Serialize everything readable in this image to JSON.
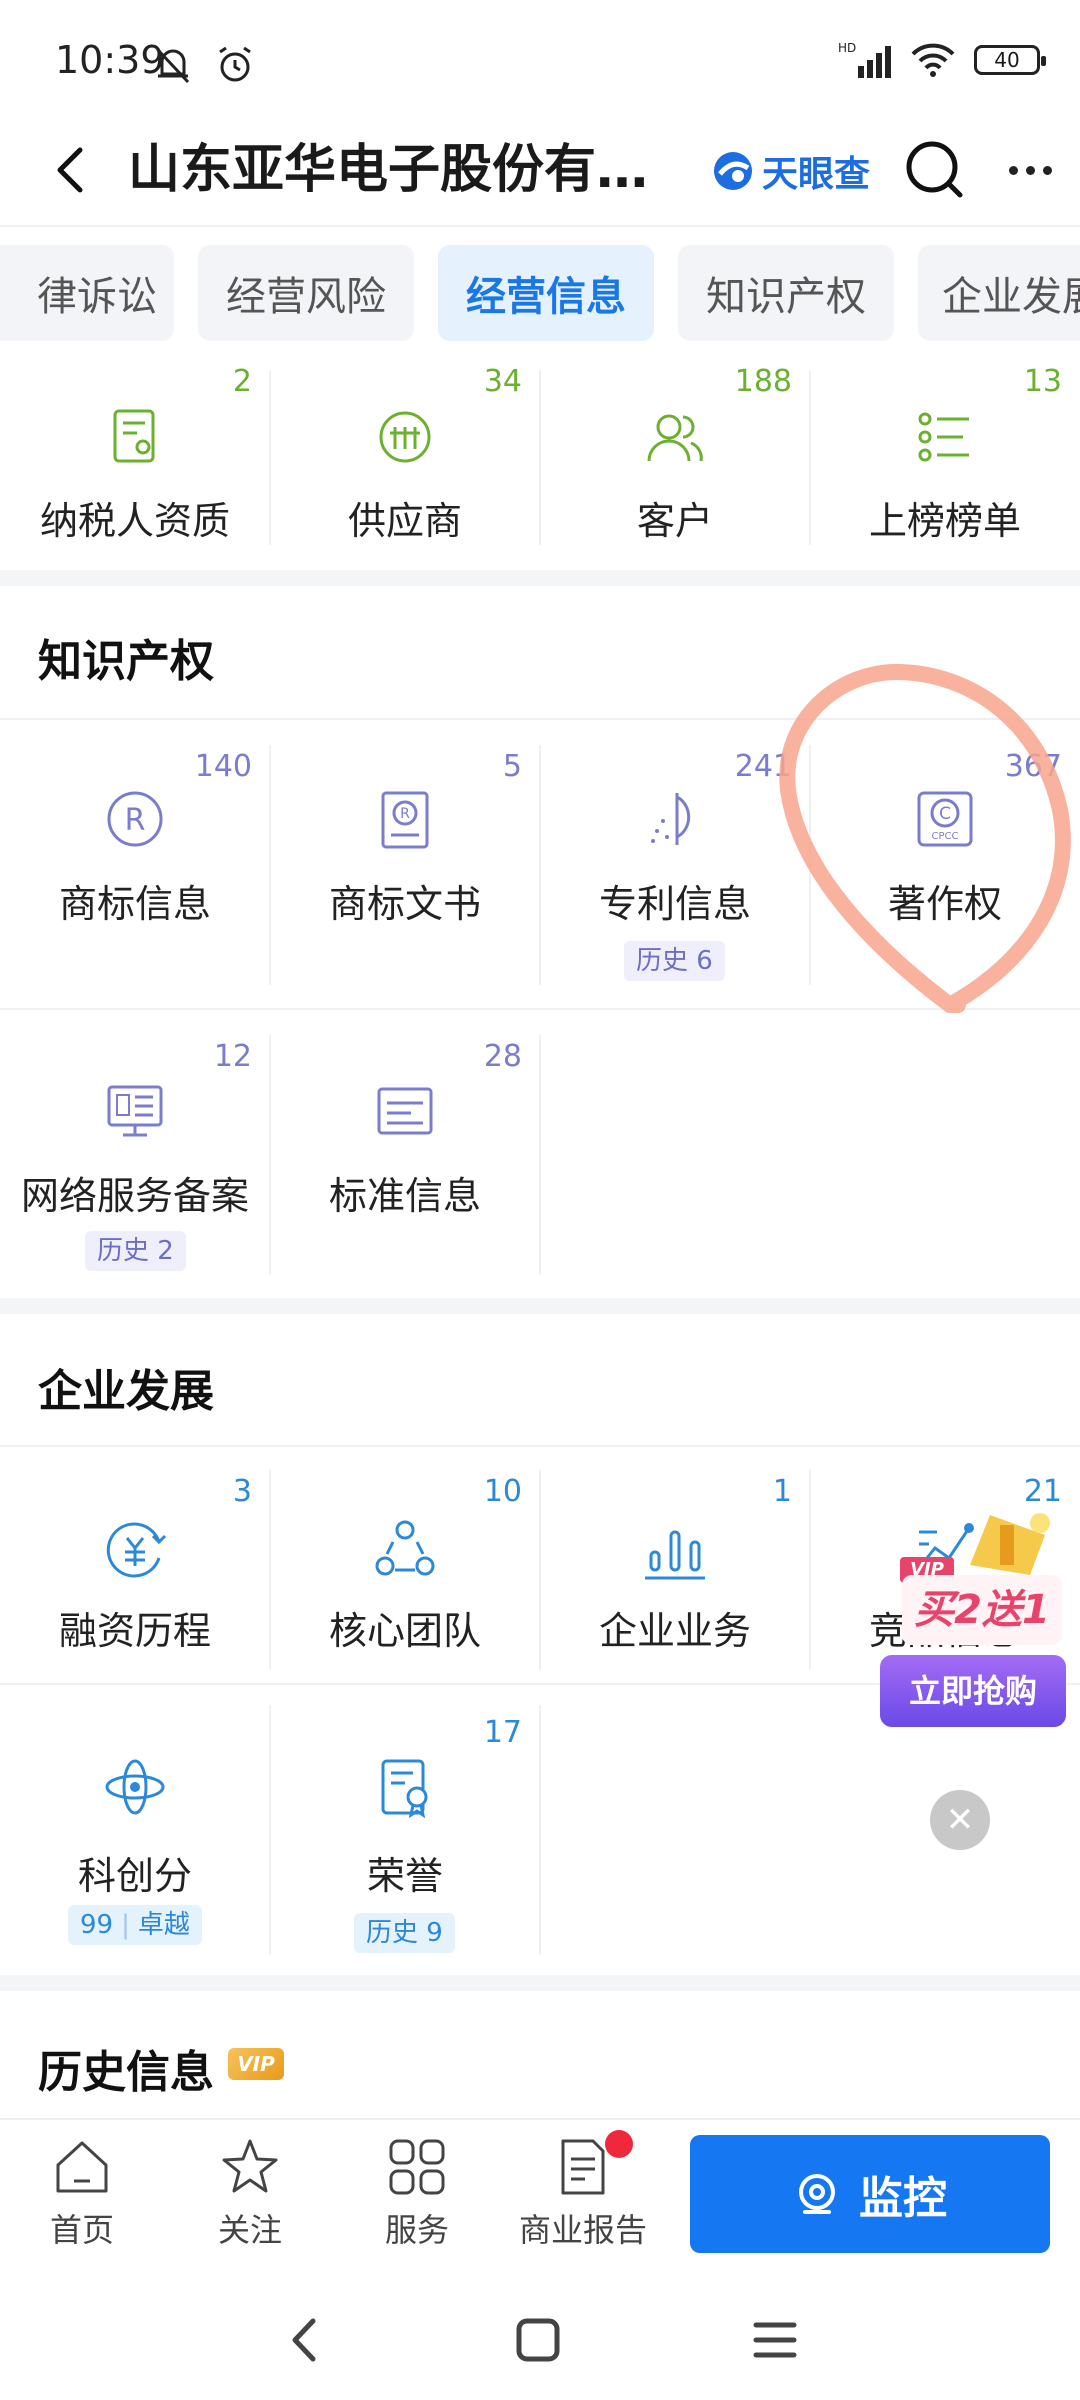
{
  "status_bar": {
    "time": "10:39",
    "network": "HD",
    "battery": "40"
  },
  "header": {
    "title": "山东亚华电子股份有限公司",
    "brand": "天眼查"
  },
  "tabs": [
    {
      "label": "律诉讼",
      "active": false
    },
    {
      "label": "经营风险",
      "active": false
    },
    {
      "label": "经营信息",
      "active": true
    },
    {
      "label": "知识产权",
      "active": false
    },
    {
      "label": "企业发展",
      "active": false
    }
  ],
  "business_row": [
    {
      "count": "2",
      "label": "纳税人资质",
      "icon": "tax-certificate-icon"
    },
    {
      "count": "34",
      "label": "供应商",
      "icon": "supplier-icon"
    },
    {
      "count": "188",
      "label": "客户",
      "icon": "customer-icon"
    },
    {
      "count": "13",
      "label": "上榜榜单",
      "icon": "ranking-list-icon"
    }
  ],
  "ip_section": {
    "title": "知识产权",
    "items": [
      {
        "count": "140",
        "label": "商标信息",
        "icon": "trademark-icon"
      },
      {
        "count": "5",
        "label": "商标文书",
        "icon": "trademark-document-icon"
      },
      {
        "count": "241",
        "label": "专利信息",
        "icon": "patent-icon",
        "history": "历史 6"
      },
      {
        "count": "367",
        "label": "著作权",
        "icon": "copyright-cpcc-icon"
      },
      {
        "count": "12",
        "label": "网络服务备案",
        "icon": "network-filing-icon",
        "history": "历史 2"
      },
      {
        "count": "28",
        "label": "标准信息",
        "icon": "standard-info-icon"
      }
    ]
  },
  "dev_section": {
    "title": "企业发展",
    "items": [
      {
        "count": "3",
        "label": "融资历程",
        "icon": "financing-icon"
      },
      {
        "count": "10",
        "label": "核心团队",
        "icon": "core-team-icon"
      },
      {
        "count": "1",
        "label": "企业业务",
        "icon": "business-chart-icon"
      },
      {
        "count": "21",
        "label": "竞品信息",
        "icon": "competitor-trend-icon"
      },
      {
        "label": "科创分",
        "icon": "tech-score-icon",
        "score": "99",
        "score_level": "卓越"
      },
      {
        "count": "17",
        "label": "荣誉",
        "icon": "honor-icon",
        "history": "历史 9"
      }
    ]
  },
  "history_section": {
    "title": "历史信息",
    "badge": "VIP"
  },
  "promo": {
    "badge": "VIP",
    "headline": "买2送1",
    "cta": "立即抢购"
  },
  "bottom_nav": [
    {
      "label": "首页",
      "icon": "home-icon"
    },
    {
      "label": "关注",
      "icon": "star-icon"
    },
    {
      "label": "服务",
      "icon": "grid-icon"
    },
    {
      "label": "商业报告",
      "icon": "report-icon"
    }
  ],
  "monitor_button": {
    "label": "监控"
  },
  "colors": {
    "accent": "#1577f1",
    "green": "#6bb02e",
    "purple": "#7a7ccd",
    "annotation": "#f7a58c"
  }
}
